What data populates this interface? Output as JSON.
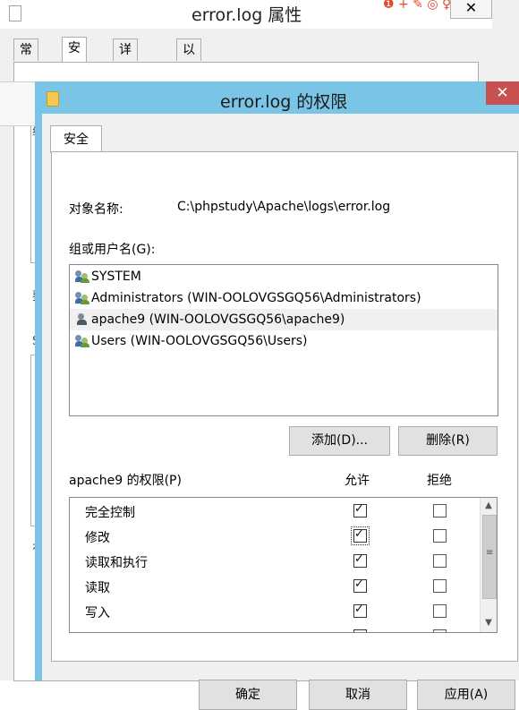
{
  "background_window": {
    "title": "error.log 属性",
    "close_label": "✕",
    "tabs": [
      "常规",
      "安全",
      "详细信息",
      "以前的版本"
    ],
    "active_tab": "安全",
    "fragments": [
      "对",
      "组",
      "要",
      "S",
      "有"
    ]
  },
  "dialog": {
    "title": "error.log 的权限",
    "close_label": "✕",
    "tab": "安全",
    "object_name_label": "对象名称:",
    "object_name_value": "C:\\phpstudy\\Apache\\logs\\error.log",
    "group_label": "组或用户名(G):",
    "users": [
      {
        "name": "SYSTEM",
        "icon": "group-users-icon",
        "selected": false
      },
      {
        "name": "Administrators (WIN-OOLOVGSGQ56\\Administrators)",
        "icon": "group-users-icon",
        "selected": false
      },
      {
        "name": "apache9 (WIN-OOLOVGSGQ56\\apache9)",
        "icon": "single-user-icon",
        "selected": true
      },
      {
        "name": "Users (WIN-OOLOVGSGQ56\\Users)",
        "icon": "group-users-icon",
        "selected": false
      }
    ],
    "add_button": "添加(D)...",
    "remove_button": "删除(R)",
    "perm_label": "apache9 的权限(P)",
    "allow_header": "允许",
    "deny_header": "拒绝",
    "permissions": [
      {
        "name": "完全控制",
        "allow": true,
        "deny": false
      },
      {
        "name": "修改",
        "allow": true,
        "deny": false
      },
      {
        "name": "读取和执行",
        "allow": true,
        "deny": false
      },
      {
        "name": "读取",
        "allow": true,
        "deny": false
      },
      {
        "name": "写入",
        "allow": true,
        "deny": false
      }
    ],
    "ok_button": "确定",
    "cancel_button": "取消",
    "apply_button": "应用(A)"
  },
  "colors": {
    "title_bar": "#7ac5e5",
    "close_button": "#c75050",
    "selected_row": "#f0f0f0"
  }
}
